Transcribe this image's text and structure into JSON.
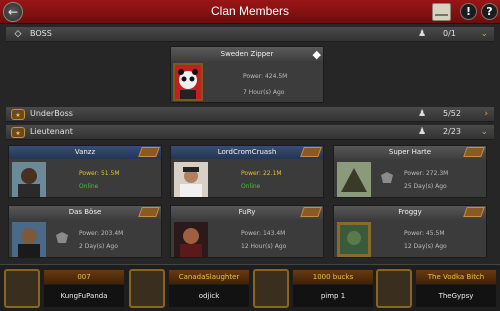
{
  "header": {
    "title": "Clan Members"
  },
  "sections": {
    "boss": {
      "label": "BOSS",
      "count": "0/1"
    },
    "underboss": {
      "label": "UnderBoss",
      "count": "5/52"
    },
    "lieutenant": {
      "label": "Lieutenant",
      "count": "2/23"
    }
  },
  "boss_card": {
    "name": "Sweden Zipper",
    "power": "Power: 424.5M",
    "ago": "7 Hour(s) Ago"
  },
  "members": [
    {
      "name": "Vanzz",
      "power": "Power: 51.5M",
      "status": "Online"
    },
    {
      "name": "LordCromCruash",
      "power": "Power: 22.1M",
      "status": "Online"
    },
    {
      "name": "Super Harte",
      "power": "Power: 272.3M",
      "status": "25 Day(s) Ago"
    },
    {
      "name": "Das Böse",
      "power": "Power: 203.4M",
      "status": "2 Day(s) Ago"
    },
    {
      "name": "FuRy",
      "power": "Power: 143.4M",
      "status": "12 Hour(s) Ago"
    },
    {
      "name": "Froggy",
      "power": "Power: 45.5M",
      "status": "12 Day(s) Ago"
    }
  ],
  "bottom": [
    {
      "title": "007",
      "sub": "KungFuPanda"
    },
    {
      "title": "CanadaSlaughter",
      "sub": "odjick"
    },
    {
      "title": "1000 bucks",
      "sub": "pimp 1"
    },
    {
      "title": "The Vodka Bitch",
      "sub": "TheGypsy"
    }
  ],
  "icons": {
    "back": "back-arrow-icon",
    "mail": "mail-icon",
    "info": "info-icon",
    "help": "help-icon"
  },
  "colors": {
    "header": "#8b1212",
    "online": "#3ec43e",
    "highlight_power": "#e6c428",
    "gold": "#f0c040"
  }
}
